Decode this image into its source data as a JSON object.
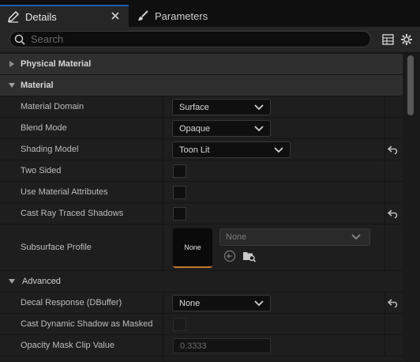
{
  "tabs": [
    {
      "label": "Details",
      "icon": "pencil-icon",
      "active": true
    },
    {
      "label": "Parameters",
      "icon": "brush-icon",
      "active": false
    }
  ],
  "search": {
    "placeholder": "Search",
    "value": ""
  },
  "toolbar": {
    "icons": [
      "table-view-icon",
      "settings-gear-icon"
    ]
  },
  "categories": {
    "physical_material": {
      "label": "Physical Material",
      "expanded": false
    },
    "material": {
      "label": "Material",
      "expanded": true
    },
    "advanced": {
      "label": "Advanced",
      "expanded": true
    }
  },
  "properties": {
    "material_domain": {
      "label": "Material Domain",
      "value": "Surface"
    },
    "blend_mode": {
      "label": "Blend Mode",
      "value": "Opaque"
    },
    "shading_model": {
      "label": "Shading Model",
      "value": "Toon Lit",
      "modified": true
    },
    "two_sided": {
      "label": "Two Sided",
      "checked": false
    },
    "use_material_attributes": {
      "label": "Use Material Attributes",
      "checked": false
    },
    "cast_ray_traced_shadows": {
      "label": "Cast Ray Traced Shadows",
      "checked": false,
      "modified": true
    },
    "subsurface_profile": {
      "label": "Subsurface Profile",
      "thumbnail_text": "None",
      "value": "None"
    },
    "decal_response": {
      "label": "Decal Response (DBuffer)",
      "value": "None",
      "modified": true
    },
    "cast_dynamic_shadow_as_masked": {
      "label": "Cast Dynamic Shadow as Masked",
      "checked": false,
      "disabled": true
    },
    "opacity_mask_clip_value": {
      "label": "Opacity Mask Clip Value",
      "value": "0.3333",
      "disabled": true
    }
  },
  "colors": {
    "background": "#1a1a1a",
    "category_header": "#2f2f2f",
    "tab_active_accent": "#1a5fb0",
    "thumbnail_accent": "#c27a2a"
  }
}
